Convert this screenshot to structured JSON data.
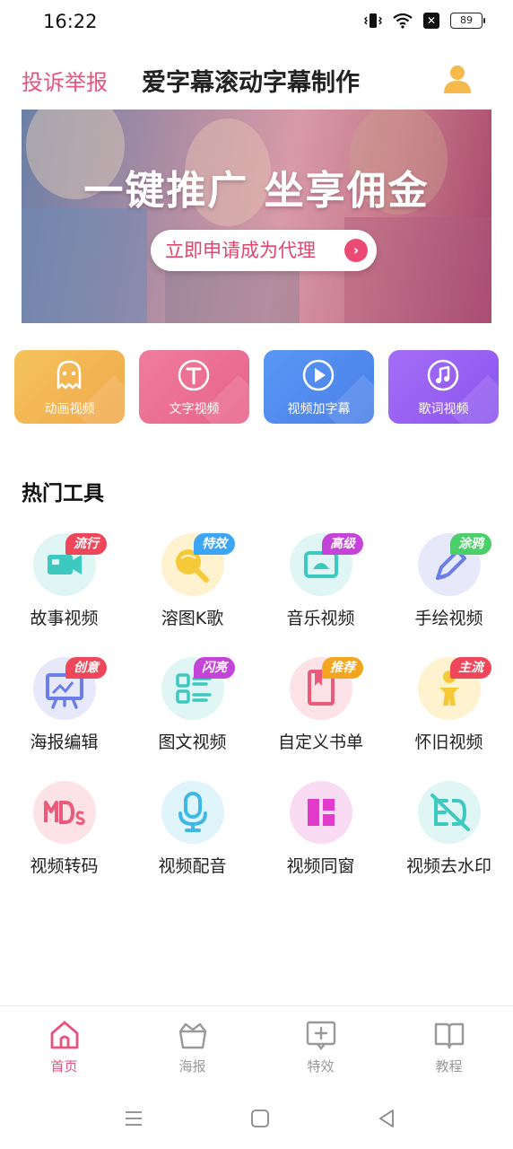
{
  "status_bar": {
    "time": "16:22",
    "battery": "89"
  },
  "header": {
    "complaint": "投诉举报",
    "title": "爱字幕滚动字幕制作"
  },
  "banner": {
    "headline": "一键推广 坐享佣金",
    "cta": "立即申请成为代理"
  },
  "quick_actions": [
    {
      "label": "动画视频",
      "icon": "ghost-icon"
    },
    {
      "label": "文字视频",
      "icon": "text-t-icon"
    },
    {
      "label": "视频加字幕",
      "icon": "play-icon"
    },
    {
      "label": "歌词视频",
      "icon": "music-note-icon"
    }
  ],
  "hot_tools": {
    "title": "热门工具",
    "items": [
      {
        "label": "故事视频",
        "badge": "流行",
        "badge_color": "#f0465a",
        "icon": "video-camera-icon"
      },
      {
        "label": "溶图K歌",
        "badge": "特效",
        "badge_color": "#3aa6f5",
        "icon": "microphone-ball-icon"
      },
      {
        "label": "音乐视频",
        "badge": "高级",
        "badge_color": "#c443d8",
        "icon": "music-video-icon"
      },
      {
        "label": "手绘视频",
        "badge": "涂鸦",
        "badge_color": "#4ccf6a",
        "icon": "pen-icon"
      },
      {
        "label": "海报编辑",
        "badge": "创意",
        "badge_color": "#f0465a",
        "icon": "easel-icon"
      },
      {
        "label": "图文视频",
        "badge": "闪亮",
        "badge_color": "#c443d8",
        "icon": "list-grid-icon"
      },
      {
        "label": "自定义书单",
        "badge": "推荐",
        "badge_color": "#f3a51f",
        "icon": "book-icon"
      },
      {
        "label": "怀旧视频",
        "badge": "主流",
        "badge_color": "#f0465a",
        "icon": "figure-icon"
      },
      {
        "label": "视频转码",
        "badge": "",
        "badge_color": "",
        "icon": "mds-transcode-icon"
      },
      {
        "label": "视频配音",
        "badge": "",
        "badge_color": "",
        "icon": "voice-mic-icon"
      },
      {
        "label": "视频同窗",
        "badge": "",
        "badge_color": "",
        "icon": "split-window-icon"
      },
      {
        "label": "视频去水印",
        "badge": "",
        "badge_color": "",
        "icon": "remove-watermark-icon"
      }
    ]
  },
  "bottom_nav": [
    {
      "label": "首页",
      "icon": "home-icon",
      "active": true
    },
    {
      "label": "海报",
      "icon": "basket-icon",
      "active": false
    },
    {
      "label": "特效",
      "icon": "plus-box-icon",
      "active": false
    },
    {
      "label": "教程",
      "icon": "book-open-icon",
      "active": false
    }
  ]
}
